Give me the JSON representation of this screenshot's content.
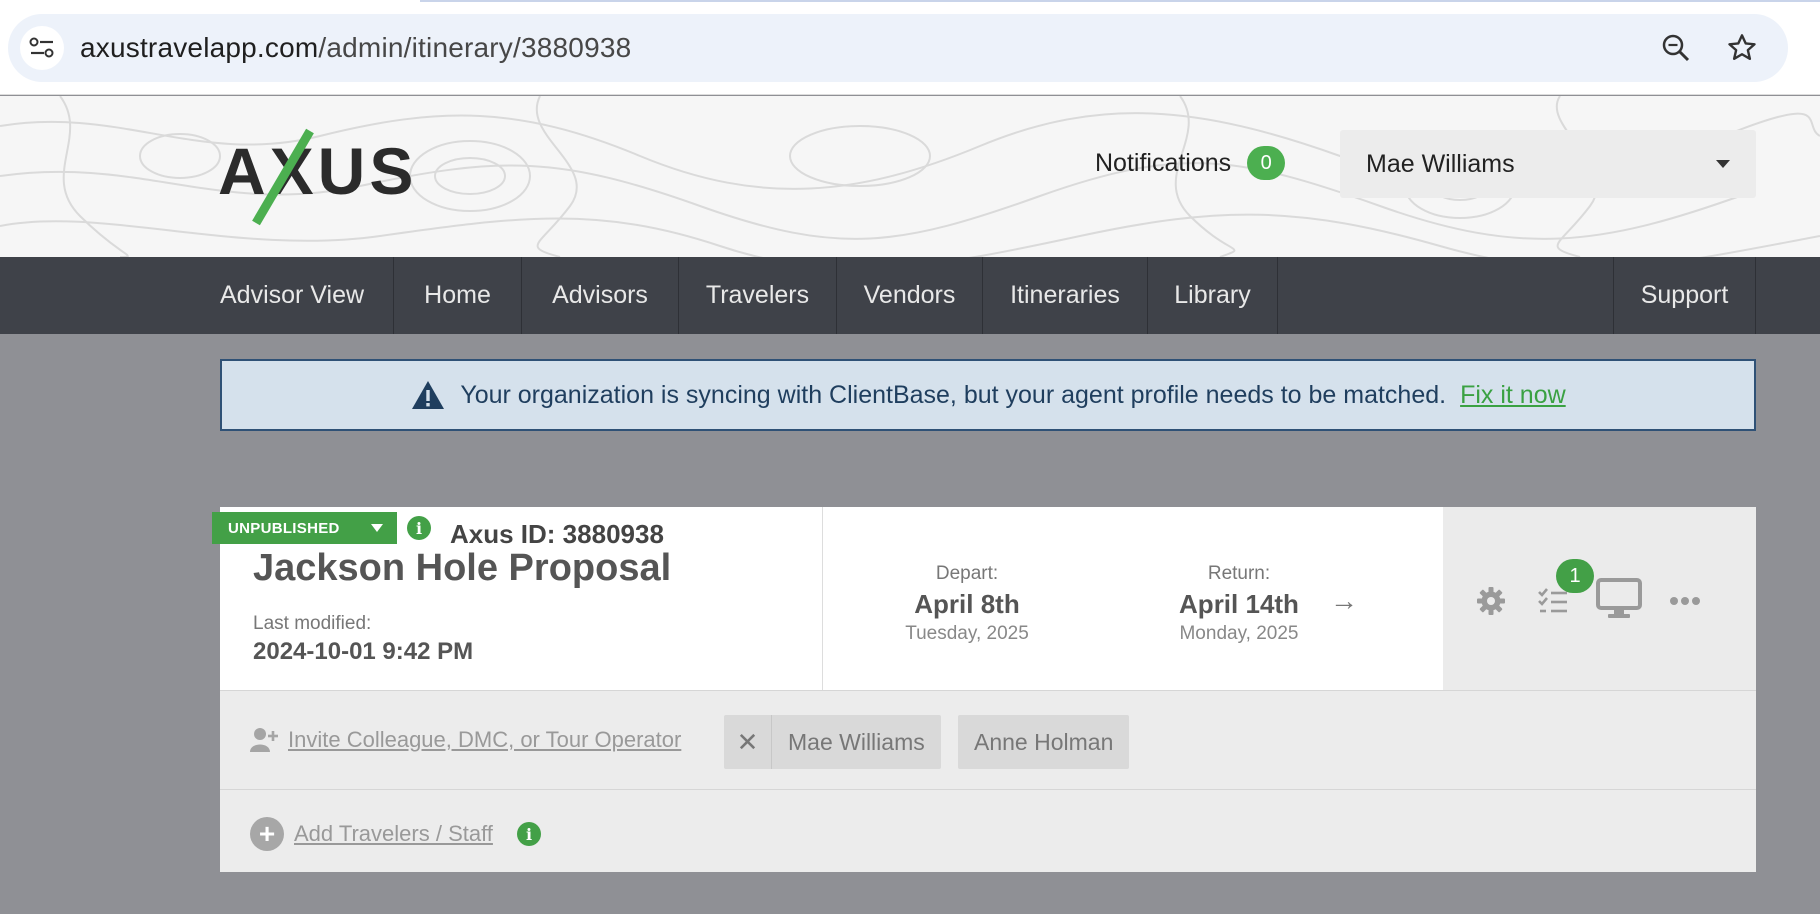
{
  "browser": {
    "url_host": "axustravelapp.com",
    "url_path": "/admin/itinerary/3880938",
    "icons": [
      "site-settings-icon",
      "zoom-icon",
      "bookmark-star-icon"
    ]
  },
  "header": {
    "logo_text": "AXUS",
    "notifications_label": "Notifications",
    "notifications_count": "0",
    "user_name": "Mae Williams"
  },
  "nav": {
    "items": [
      {
        "label": "Advisor View"
      },
      {
        "label": "Home"
      },
      {
        "label": "Advisors"
      },
      {
        "label": "Travelers"
      },
      {
        "label": "Vendors"
      },
      {
        "label": "Itineraries"
      },
      {
        "label": "Library"
      }
    ],
    "support_label": "Support"
  },
  "alert": {
    "message": "Your organization is syncing with ClientBase, but your agent profile needs to be matched.",
    "link_label": "Fix it now"
  },
  "itinerary": {
    "status": "UNPUBLISHED",
    "axus_id_label": "Axus ID: 3880938",
    "title": "Jackson Hole Proposal",
    "modified_label": "Last modified:",
    "modified_value": "2024-10-01 9:42 PM",
    "depart": {
      "label": "Depart:",
      "date": "April 8th",
      "sub": "Tuesday, 2025"
    },
    "return": {
      "label": "Return:",
      "date": "April 14th",
      "sub": "Monday, 2025"
    },
    "arrow": "→",
    "task_count": "1",
    "invite_label": "Invite Colleague, DMC, or Tour Operator",
    "collaborators": [
      {
        "name": "Mae Williams",
        "removable": true
      },
      {
        "name": "Anne Holman",
        "removable": false
      }
    ],
    "add_travelers_label": "Add Travelers / Staff"
  },
  "colors": {
    "accent_green": "#43a047",
    "nav_bg": "#3f4249",
    "alert_border": "#2f5176",
    "page_bg": "#8f9095"
  }
}
